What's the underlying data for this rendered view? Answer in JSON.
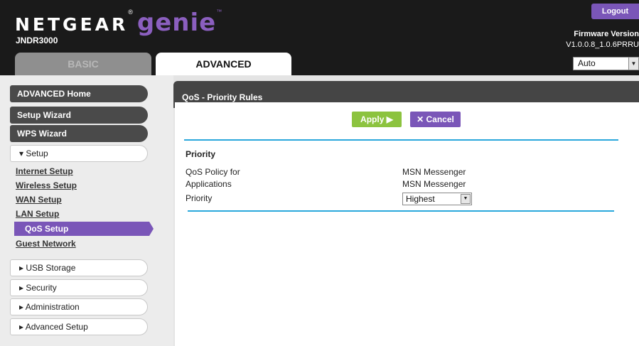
{
  "brand": {
    "netgear": "NETGEAR",
    "reg": "®",
    "genie": "genie",
    "tm": "™"
  },
  "model": "JNDR3000",
  "header": {
    "logout_label": "Logout",
    "firmware_label": "Firmware Version",
    "firmware_value": "V1.0.0.8_1.0.6PRRU",
    "language": "Auto"
  },
  "tabs": {
    "basic": "BASIC",
    "advanced": "ADVANCED"
  },
  "sidebar": {
    "main": {
      "advanced_home": "ADVANCED Home",
      "setup_wizard": "Setup Wizard",
      "wps_wizard": "WPS Wizard"
    },
    "setup": "▾ Setup",
    "sub_items": [
      "Internet Setup",
      "Wireless Setup",
      "WAN Setup",
      "LAN Setup",
      "QoS Setup",
      "Guest Network"
    ],
    "groups": {
      "usb_storage": "▸ USB Storage",
      "security": "▸ Security",
      "administration": "▸ Administration",
      "advanced_setup": "▸ Advanced Setup"
    }
  },
  "panel": {
    "title": "QoS - Priority Rules",
    "apply_label": "Apply ▶",
    "cancel_label": "✕ Cancel",
    "section_title": "Priority",
    "policy_label_line1": "QoS Policy for",
    "policy_value": "MSN Messenger",
    "applications_label": "Applications",
    "applications_value": "MSN Messenger",
    "priority_label": "Priority",
    "priority_value": "Highest"
  },
  "colors": {
    "accent_purple": "#7a56b8",
    "apply_green": "#8cc33f",
    "rule_blue": "#2aa8dc",
    "header_dark": "#1a1a1a"
  }
}
